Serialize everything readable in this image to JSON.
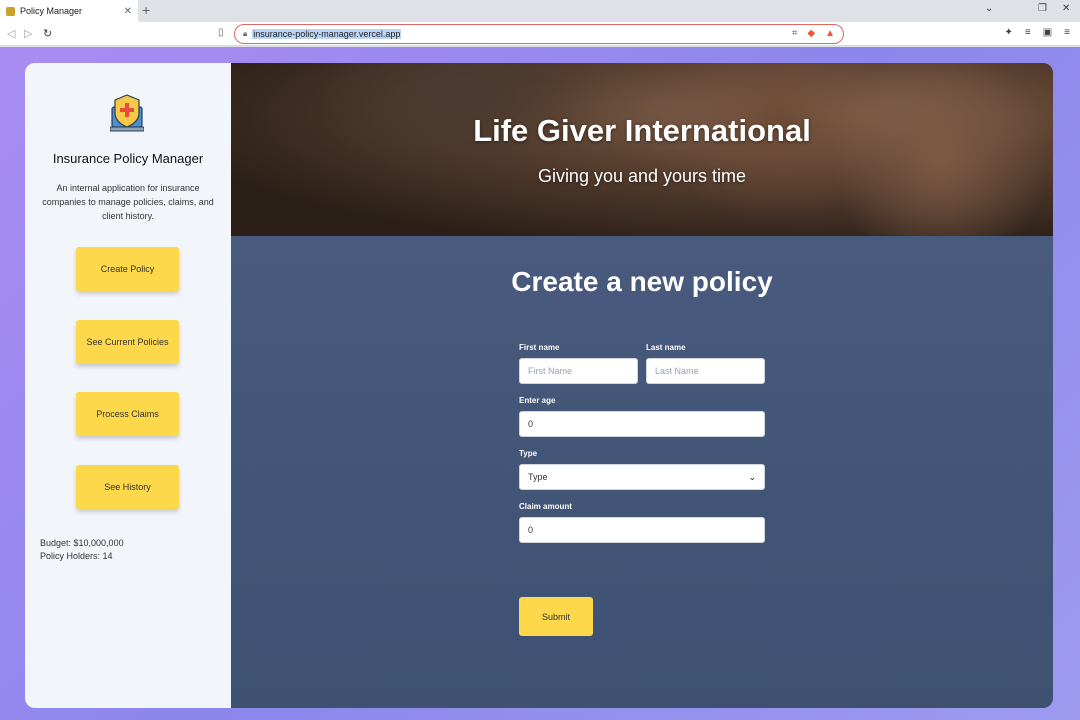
{
  "browser": {
    "tab_title": "Policy Manager",
    "url": "insurance-policy-manager.vercel.app"
  },
  "sidebar": {
    "app_title": "Insurance Policy Manager",
    "description": "An internal application for insurance companies to manage policies, claims, and client history.",
    "buttons": [
      "Create Policy",
      "See Current Policies",
      "Process Claims",
      "See History"
    ],
    "budget": "Budget: $10,000,000",
    "policy_holders": "Policy Holders: 14"
  },
  "hero": {
    "title": "Life Giver International",
    "subtitle": "Giving you and yours time"
  },
  "form": {
    "title": "Create a new policy",
    "first_name_label": "First name",
    "first_name_placeholder": "First Name",
    "last_name_label": "Last name",
    "last_name_placeholder": "Last Name",
    "age_label": "Enter age",
    "age_value": "0",
    "type_label": "Type",
    "type_value": "Type",
    "claim_label": "Claim amount",
    "claim_value": "0",
    "submit_label": "Submit"
  },
  "colors": {
    "accent": "#fcd84a",
    "main_bg": "#46587a",
    "sidebar_bg": "#f2f6fb",
    "page_bg": "#9a8ef0"
  }
}
